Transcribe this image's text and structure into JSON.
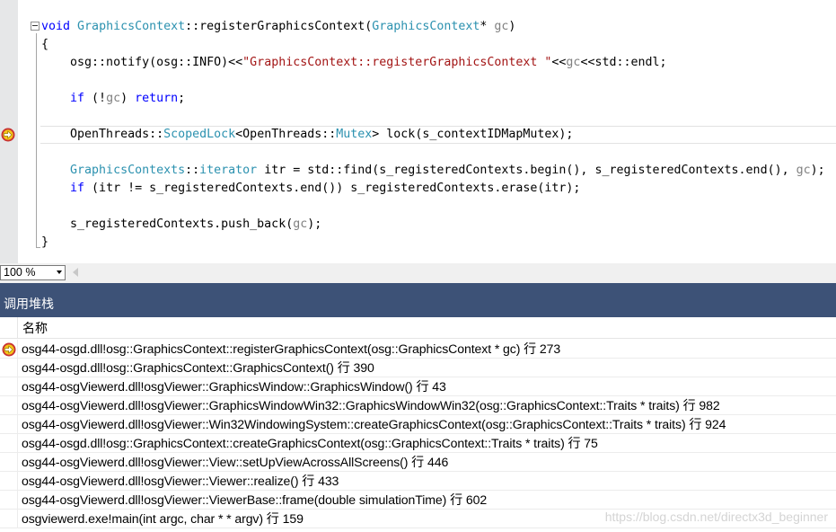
{
  "editor": {
    "lines": [
      [
        {
          "t": "void",
          "c": "kw"
        },
        {
          "t": " "
        },
        {
          "t": "GraphicsContext",
          "c": "ty"
        },
        {
          "t": "::registerGraphicsContext("
        },
        {
          "t": "GraphicsContext",
          "c": "ty"
        },
        {
          "t": "* "
        },
        {
          "t": "gc",
          "c": "par"
        },
        {
          "t": ")"
        }
      ],
      [
        {
          "t": "{"
        }
      ],
      [
        {
          "t": "osg::notify(osg::INFO)<<"
        },
        {
          "t": "\"GraphicsContext::registerGraphicsContext \"",
          "c": "str"
        },
        {
          "t": "<<"
        },
        {
          "t": "gc",
          "c": "par"
        },
        {
          "t": "<<std::endl;"
        }
      ],
      [],
      [
        {
          "t": "if",
          "c": "kw"
        },
        {
          "t": " (!"
        },
        {
          "t": "gc",
          "c": "par"
        },
        {
          "t": ") "
        },
        {
          "t": "return",
          "c": "kw"
        },
        {
          "t": ";"
        }
      ],
      [],
      [
        {
          "t": "OpenThreads::"
        },
        {
          "t": "ScopedLock",
          "c": "ty"
        },
        {
          "t": "<OpenThreads::"
        },
        {
          "t": "Mutex",
          "c": "ty"
        },
        {
          "t": "> lock(s_contextIDMapMutex);"
        }
      ],
      [],
      [
        {
          "t": "GraphicsContexts",
          "c": "ty"
        },
        {
          "t": "::"
        },
        {
          "t": "iterator",
          "c": "ty"
        },
        {
          "t": " itr = std::find(s_registeredContexts.begin(), s_registeredContexts.end(), "
        },
        {
          "t": "gc",
          "c": "par"
        },
        {
          "t": ");"
        }
      ],
      [
        {
          "t": "if",
          "c": "kw"
        },
        {
          "t": " (itr != s_registeredContexts.end()) s_registeredContexts.erase(itr);"
        }
      ],
      [],
      [
        {
          "t": "s_registeredContexts.push_back("
        },
        {
          "t": "gc",
          "c": "par"
        },
        {
          "t": ");"
        }
      ],
      [
        {
          "t": "}"
        }
      ]
    ],
    "indents": [
      "",
      "",
      "    ",
      "",
      "    ",
      "",
      "    ",
      "",
      "    ",
      "    ",
      "",
      "    ",
      ""
    ]
  },
  "zoom": {
    "value": "100 %"
  },
  "call_stack": {
    "title": "调用堆栈",
    "column_name": "名称",
    "rows": [
      "osg44-osgd.dll!osg::GraphicsContext::registerGraphicsContext(osg::GraphicsContext * gc) 行 273",
      "osg44-osgd.dll!osg::GraphicsContext::GraphicsContext() 行 390",
      "osg44-osgViewerd.dll!osgViewer::GraphicsWindow::GraphicsWindow() 行 43",
      "osg44-osgViewerd.dll!osgViewer::GraphicsWindowWin32::GraphicsWindowWin32(osg::GraphicsContext::Traits * traits) 行 982",
      "osg44-osgViewerd.dll!osgViewer::Win32WindowingSystem::createGraphicsContext(osg::GraphicsContext::Traits * traits) 行 924",
      "osg44-osgd.dll!osg::GraphicsContext::createGraphicsContext(osg::GraphicsContext::Traits * traits) 行 75",
      "osg44-osgViewerd.dll!osgViewer::View::setUpViewAcrossAllScreens() 行 446",
      "osg44-osgViewerd.dll!osgViewer::Viewer::realize() 行 433",
      "osg44-osgViewerd.dll!osgViewer::ViewerBase::frame(double simulationTime) 行 602",
      "osgviewerd.exe!main(int argc, char * * argv) 行 159"
    ]
  },
  "watermark": "https://blog.csdn.net/directx3d_beginner",
  "colors": {
    "keyword": "#0000ff",
    "type": "#2b91af",
    "parameter": "#808080",
    "string": "#a31515",
    "panel_title_bg": "#3d5277",
    "current_statement_marker": "#f5c518"
  },
  "icons": {
    "breakpoint": "current-statement-arrow-icon",
    "zoom_dropdown": "chevron-down-icon",
    "scroll_left": "scroll-left-arrow-icon"
  }
}
